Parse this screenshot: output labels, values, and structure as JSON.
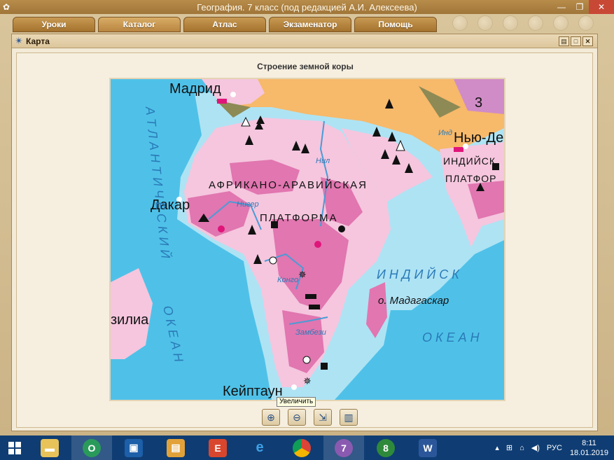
{
  "window": {
    "title": "География. 7 класс (под редакцией А.И. Алексеева)",
    "min": "—",
    "max": "❐",
    "close": "✕"
  },
  "tabs": [
    {
      "label": "Уроки"
    },
    {
      "label": "Каталог"
    },
    {
      "label": "Атлас"
    },
    {
      "label": "Экзаменатор"
    },
    {
      "label": "Помощь"
    }
  ],
  "map_window": {
    "title": "Карта",
    "map_title": "Строение земной коры",
    "tooltip": "Увеличить"
  },
  "map_labels": {
    "madrid": "Мадрид",
    "dakar": "Дакар",
    "capetown": "Кейптаун",
    "newdelhi": "Нью-Де",
    "brazil": "зилиа",
    "platform_ar1": "АФРИКАНО-АРАВИЙСКАЯ",
    "platform_ar2": "ПЛАТФОРМА",
    "indian1": "ИНДИЙСК.",
    "indian2": "ПЛАТФОР",
    "madagascar": "о. Мадагаскар",
    "ocean_in1": "И Н Д И Й С К",
    "ocean_in2": "О К Е А Н",
    "ocean_at1": "А Т Л А Н Т И Ч Е С К И Й",
    "ocean_at2": "О К Е А Н",
    "nile": "Нил",
    "niger": "Нигер",
    "congo": "Конго",
    "zambezi": "Замбези",
    "ind": "Инд",
    "num3": "3"
  },
  "colors": {
    "ocean_deep": "#4fc1e8",
    "ocean_shallow": "#aee3f4",
    "platform": "#f5c6de",
    "shield": "#e176b0",
    "fold": "#f7b96a",
    "olive": "#8d8a55"
  },
  "taskbar": {
    "lang": "РУС",
    "time": "8:11",
    "date": "18.01.2019"
  }
}
